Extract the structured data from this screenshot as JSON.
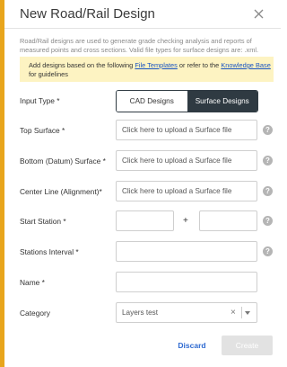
{
  "dialog": {
    "title": "New Road/Rail Design",
    "description": "Road/Rail designs are used to generate grade checking analysis and reports of measured points and cross sections. Valid file types for surface designs are: .xml.",
    "notice": {
      "prefix": "Add designs based on the following ",
      "link1": "File Templates",
      "middle": " or refer to the ",
      "link2": "Knowledge Base",
      "suffix": "for guidelines"
    }
  },
  "form": {
    "input_type": {
      "label": "Input Type *",
      "options": [
        "CAD Designs",
        "Surface Designs"
      ],
      "selected": "Surface Designs"
    },
    "top_surface": {
      "label": "Top Surface *",
      "placeholder": "Click here to upload a Surface file"
    },
    "bottom_surface": {
      "label": "Bottom (Datum) Surface *",
      "placeholder": "Click here to upload a Surface file"
    },
    "center_line": {
      "label": "Center Line (Alignment)*",
      "placeholder": "Click here to upload a Surface file"
    },
    "start_station": {
      "label": "Start Station *",
      "separator": "+"
    },
    "stations_interval": {
      "label": "Stations Interval *"
    },
    "name": {
      "label": "Name *"
    },
    "category": {
      "label": "Category",
      "value": "Layers test",
      "clear": "×"
    }
  },
  "actions": {
    "discard": "Discard",
    "create": "Create"
  },
  "colors": {
    "accent": "#e8a51c",
    "toggle_active": "#2f3a42",
    "link": "#2e6ad1",
    "notice_bg": "#fdf3c2"
  },
  "icons": {
    "close": "close-icon",
    "help": "help-icon",
    "dropdown": "chevron-down-icon"
  }
}
